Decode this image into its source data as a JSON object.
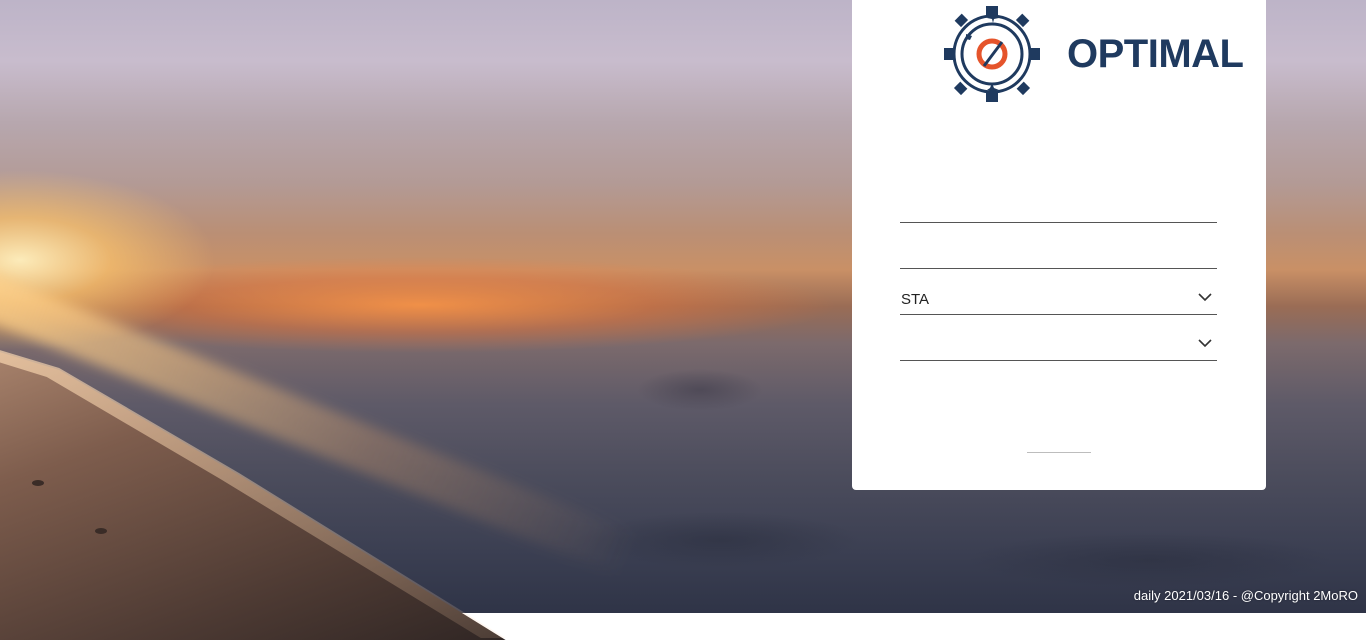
{
  "login": {
    "logo_text": "OPTIMAL",
    "username": {
      "value": "",
      "placeholder": ""
    },
    "password": {
      "value": "",
      "placeholder": ""
    },
    "select_1": {
      "value": "STA"
    },
    "select_2": {
      "value": ""
    }
  },
  "footer": {
    "text": "daily 2021/03/16 - @Copyright 2MoRO"
  },
  "colors": {
    "brand": "#1f3a5f",
    "accent": "#e5542b",
    "card_bg": "#ffffff"
  },
  "icons": {
    "logo": "optimal-gear-logo",
    "select_arrow": "chevron-down-icon"
  }
}
